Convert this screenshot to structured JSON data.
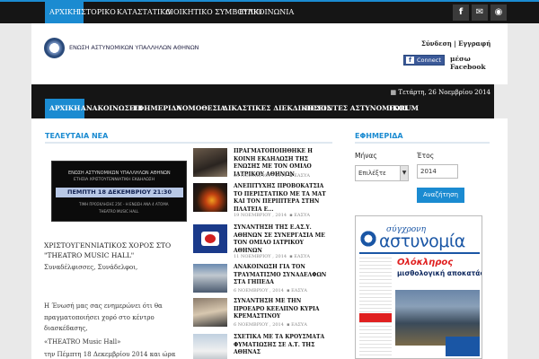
{
  "topbar": {
    "nav": [
      "ΑΡΧΙΚΗ",
      "ΙΣΤΟΡΙΚΟ",
      "ΚΑΤΑΣΤΑΤΙΚΟ",
      "ΔΙΟΙΚΗΤΙΚΟ ΣΥΜΒΟΥΛΙΟ",
      "ΕΠΙΚΟΙΝΩΝΙΑ"
    ],
    "social": [
      {
        "icon": "facebook-icon",
        "glyph": "f"
      },
      {
        "icon": "mail-icon",
        "glyph": "✉"
      },
      {
        "icon": "rss-icon",
        "glyph": "◉"
      }
    ]
  },
  "header": {
    "logo_text": "ΕΝΩΣΗ ΑΣΤΥΝΟΜΙΚΩΝ ΥΠΑΛΛΗΛΩΝ ΑΘΗΝΩΝ",
    "login": "Σύνδεση | Εγγραφή",
    "fb_connect": "Connect",
    "fb_glyph": "f",
    "via_facebook": "μέσω Facebook"
  },
  "mainnav": {
    "date": "Τετάρτη, 26 Νοεμβρίου 2014",
    "calendar_icon": "▦",
    "items": [
      "ΑΡΧΙΚΗ",
      "ΑΝΑΚΟΙΝΩΣΕΙΣ",
      "ΕΦΗΜΕΡΙΔΑ",
      "ΝΟΜΟΘΕΣΙΑ",
      "ΔΙΚΑΣΤΙΚΕΣ ΔΙΕΚΔΙΚΗΣΕΙΣ",
      "ΠΕΣΟΝΤΕΣ ΑΣΤΥΝΟΜΙΚΟΙ",
      "FORUM"
    ]
  },
  "latest": {
    "heading": "ΤΕΛΕΥΤΑΙΑ ΝΕΑ",
    "feature_image": {
      "line1": "ΕΝΩΣΗ ΑΣΤΥΝΟΜΙΚΩΝ ΥΠΑΛΛΗΛΩΝ ΑΘΗΝΩΝ",
      "line2": "ΕΤΗΣΙΑ ΧΡΙΣΤΟΥΓΕΝΝΙΑΤΙΚΗ ΕΚΔΗΛΩΣΗ",
      "band": "ΠΕΜΠΤΗ 18 ΔΕΚΕΜΒΡΙΟΥ 21:30",
      "line3": "ΤΙΜΗ ΠΡΟΣΚΛΗΣΗΣ 25€ - Η ΕΝΩΣΗ ΑΝΑ 4 ΑΤΟΜΑ",
      "line4": "THEATRO MUSIC HALL"
    },
    "feature_title": "ΧΡΙΣΤΟΥΓΕΝΝΙΑΤΙΚΟΣ ΧΟΡΟΣ ΣΤΟ \"THEATRO MUSIC HALL\"",
    "excerpt": [
      "Συναδέλφισσες, Συνάδελφοι,",
      "Η Ένωσή μας σας ενημερώνει ότι θα",
      "πραγματοποιήσει χορό στο κέντρο",
      "διασκέδασης,",
      "«THEATRO Music Hall»",
      "την Πέμπτη 18 Δεκεμβρίου 2014 και ώρα"
    ]
  },
  "news": [
    {
      "title": "ΠΡΑΓΜΑΤΟΠΟΙΗΘΗΚΕ Η ΚΟΙΝΗ ΕΚΔΗΛΩΣΗ ΤΗΣ ΕΝΩΣΗΣ ΜΕ ΤΟΝ ΟΜΙΛΟ ΙΑΤΡΙΚΟΥ ΑΘΗΝΩΝ",
      "date": "23 ΝΟΕΜΒΡΙΟΥ , 2014",
      "author": "ΕΑΣΥΑ"
    },
    {
      "title": "ΑΝΕΠΙΤΥΧΗΣ ΠΡΟΒΟΚΑΤΣΙΑ ΤΟ ΠΕΡΙΣΤΑΤΙΚΟ ΜΕ ΤΑ ΜΑΤ ΚΑΙ ΤΟΝ ΠΕΡΙΠΤΕΡΑ ΣΤΗΝ ΠΛΑΤΕΙΑ Ε...",
      "date": "19 ΝΟΕΜΒΡΙΟΥ , 2014",
      "author": "ΕΑΣΥΑ"
    },
    {
      "title": "ΣΥΝΑΝΤΗΣΗ ΤΗΣ Ε.ΑΣ.Υ. ΑΘΗΝΩΝ ΣΕ ΣΥΝΕΡΓΑΣΙΑ ΜΕ ΤΟΝ ΟΜΙΛΟ ΙΑΤΡΙΚΟΥ ΑΘΗΝΩΝ",
      "date": "11 ΝΟΕΜΒΡΙΟΥ , 2014",
      "author": "ΕΑΣΥΑ"
    },
    {
      "title": "ΑΝΑΚΟΙΝΩΣΗ ΓΙΑ ΤΟΝ ΤΡΑΥΜΑΤΙΣΜΟ ΣΥΝΑΔΕΛΦΩΝ ΣΤΑ ΓΗΠΕΔΑ",
      "date": "6 ΝΟΕΜΒΡΙΟΥ , 2014",
      "author": "ΕΑΣΥΑ"
    },
    {
      "title": "ΣΥΝΑΝΤΗΣΗ ΜΕ ΤΗΝ ΠΡΟΕΔΡΟ ΚΕΕΛΠΝΟ ΚΥΡΙΑ ΚΡΕΜΑΣΤΙΝΟΥ",
      "date": "6 ΝΟΕΜΒΡΙΟΥ , 2014",
      "author": "ΕΑΣΥΑ"
    },
    {
      "title": "ΣΧΕΤΙΚΑ ΜΕ ΤΑ ΚΡΟΥΣΜΑΤΑ ΦΥΜΑΤΙΩΣΗΣ ΣΕ Α.Τ. ΤΗΣ ΑΘΗΝΑΣ",
      "date": "",
      "author": ""
    }
  ],
  "newspaper": {
    "heading": "ΕΦΗΜΕΡΙΔΑ",
    "month_label": "Μήνας",
    "year_label": "Έτος",
    "month_value": "Επιλέξτε",
    "year_value": "2014",
    "search_label": "Αναζήτηση",
    "cover": {
      "masthead_small": "σύγχρονη",
      "masthead_big": "αστυνομία",
      "headline_red": "Ολόκληρος",
      "headline_rest": "μισθολογική αποκατάσταση"
    }
  },
  "colors": {
    "accent": "#1b8bd1",
    "dark": "#151515",
    "fb": "#3b5998"
  }
}
